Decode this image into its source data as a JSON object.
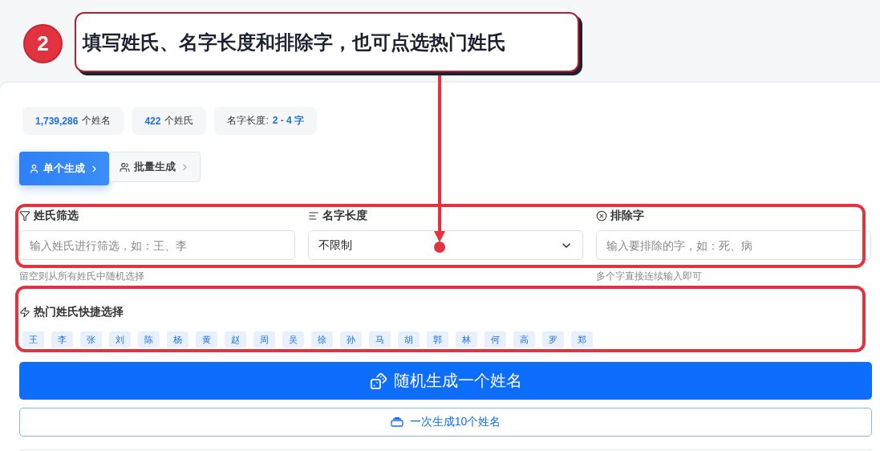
{
  "annotation": {
    "step": "2",
    "text": "填写姓氏、名字长度和排除字，也可点选热门姓氏"
  },
  "stats": [
    {
      "kind": "count",
      "value": "1,739,286",
      "label": "个姓名"
    },
    {
      "kind": "count",
      "value": "422",
      "label": "个姓氏"
    },
    {
      "kind": "range",
      "label": "名字长度:",
      "value": "2 - 4 字"
    }
  ],
  "tabs": [
    {
      "label": "单个生成",
      "selected": true
    },
    {
      "label": "批量生成",
      "selected": false
    }
  ],
  "filters": [
    {
      "kind": "input",
      "label": "姓氏筛选",
      "placeholder": "输入姓氏进行筛选，如：王、李",
      "hint": "留空则从所有姓氏中随机选择"
    },
    {
      "kind": "select",
      "label": "名字长度",
      "value": "不限制"
    },
    {
      "kind": "input",
      "label": "排除字",
      "placeholder": "输入要排除的字，如：死、病",
      "hint": "多个字直接连续输入即可"
    }
  ],
  "hot_surnames": {
    "title": "热门姓氏快捷选择",
    "items": [
      "王",
      "李",
      "张",
      "刘",
      "陈",
      "杨",
      "黄",
      "赵",
      "周",
      "吴",
      "徐",
      "孙",
      "马",
      "胡",
      "郭",
      "林",
      "何",
      "高",
      "罗",
      "郑"
    ]
  },
  "buttons": [
    {
      "kind": "primary",
      "label": "随机生成一个姓名"
    },
    {
      "kind": "secondary",
      "label": "一次生成10个姓名"
    }
  ]
}
